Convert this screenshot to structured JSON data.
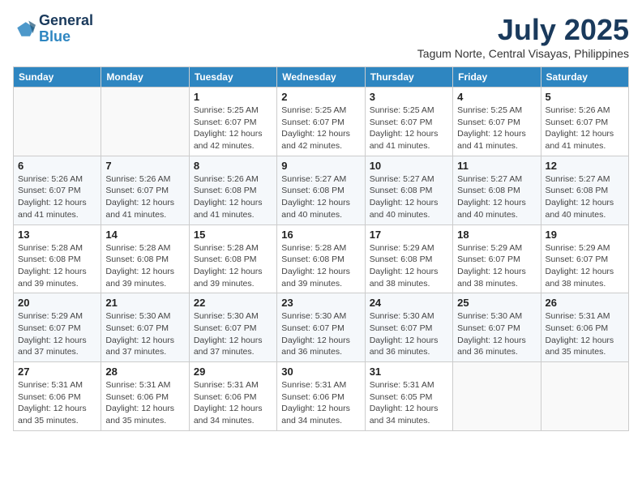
{
  "header": {
    "logo_line1": "General",
    "logo_line2": "Blue",
    "month": "July 2025",
    "location": "Tagum Norte, Central Visayas, Philippines"
  },
  "weekdays": [
    "Sunday",
    "Monday",
    "Tuesday",
    "Wednesday",
    "Thursday",
    "Friday",
    "Saturday"
  ],
  "weeks": [
    [
      {
        "day": "",
        "info": ""
      },
      {
        "day": "",
        "info": ""
      },
      {
        "day": "1",
        "info": "Sunrise: 5:25 AM\nSunset: 6:07 PM\nDaylight: 12 hours and 42 minutes."
      },
      {
        "day": "2",
        "info": "Sunrise: 5:25 AM\nSunset: 6:07 PM\nDaylight: 12 hours and 42 minutes."
      },
      {
        "day": "3",
        "info": "Sunrise: 5:25 AM\nSunset: 6:07 PM\nDaylight: 12 hours and 41 minutes."
      },
      {
        "day": "4",
        "info": "Sunrise: 5:25 AM\nSunset: 6:07 PM\nDaylight: 12 hours and 41 minutes."
      },
      {
        "day": "5",
        "info": "Sunrise: 5:26 AM\nSunset: 6:07 PM\nDaylight: 12 hours and 41 minutes."
      }
    ],
    [
      {
        "day": "6",
        "info": "Sunrise: 5:26 AM\nSunset: 6:07 PM\nDaylight: 12 hours and 41 minutes."
      },
      {
        "day": "7",
        "info": "Sunrise: 5:26 AM\nSunset: 6:07 PM\nDaylight: 12 hours and 41 minutes."
      },
      {
        "day": "8",
        "info": "Sunrise: 5:26 AM\nSunset: 6:08 PM\nDaylight: 12 hours and 41 minutes."
      },
      {
        "day": "9",
        "info": "Sunrise: 5:27 AM\nSunset: 6:08 PM\nDaylight: 12 hours and 40 minutes."
      },
      {
        "day": "10",
        "info": "Sunrise: 5:27 AM\nSunset: 6:08 PM\nDaylight: 12 hours and 40 minutes."
      },
      {
        "day": "11",
        "info": "Sunrise: 5:27 AM\nSunset: 6:08 PM\nDaylight: 12 hours and 40 minutes."
      },
      {
        "day": "12",
        "info": "Sunrise: 5:27 AM\nSunset: 6:08 PM\nDaylight: 12 hours and 40 minutes."
      }
    ],
    [
      {
        "day": "13",
        "info": "Sunrise: 5:28 AM\nSunset: 6:08 PM\nDaylight: 12 hours and 39 minutes."
      },
      {
        "day": "14",
        "info": "Sunrise: 5:28 AM\nSunset: 6:08 PM\nDaylight: 12 hours and 39 minutes."
      },
      {
        "day": "15",
        "info": "Sunrise: 5:28 AM\nSunset: 6:08 PM\nDaylight: 12 hours and 39 minutes."
      },
      {
        "day": "16",
        "info": "Sunrise: 5:28 AM\nSunset: 6:08 PM\nDaylight: 12 hours and 39 minutes."
      },
      {
        "day": "17",
        "info": "Sunrise: 5:29 AM\nSunset: 6:08 PM\nDaylight: 12 hours and 38 minutes."
      },
      {
        "day": "18",
        "info": "Sunrise: 5:29 AM\nSunset: 6:07 PM\nDaylight: 12 hours and 38 minutes."
      },
      {
        "day": "19",
        "info": "Sunrise: 5:29 AM\nSunset: 6:07 PM\nDaylight: 12 hours and 38 minutes."
      }
    ],
    [
      {
        "day": "20",
        "info": "Sunrise: 5:29 AM\nSunset: 6:07 PM\nDaylight: 12 hours and 37 minutes."
      },
      {
        "day": "21",
        "info": "Sunrise: 5:30 AM\nSunset: 6:07 PM\nDaylight: 12 hours and 37 minutes."
      },
      {
        "day": "22",
        "info": "Sunrise: 5:30 AM\nSunset: 6:07 PM\nDaylight: 12 hours and 37 minutes."
      },
      {
        "day": "23",
        "info": "Sunrise: 5:30 AM\nSunset: 6:07 PM\nDaylight: 12 hours and 36 minutes."
      },
      {
        "day": "24",
        "info": "Sunrise: 5:30 AM\nSunset: 6:07 PM\nDaylight: 12 hours and 36 minutes."
      },
      {
        "day": "25",
        "info": "Sunrise: 5:30 AM\nSunset: 6:07 PM\nDaylight: 12 hours and 36 minutes."
      },
      {
        "day": "26",
        "info": "Sunrise: 5:31 AM\nSunset: 6:06 PM\nDaylight: 12 hours and 35 minutes."
      }
    ],
    [
      {
        "day": "27",
        "info": "Sunrise: 5:31 AM\nSunset: 6:06 PM\nDaylight: 12 hours and 35 minutes."
      },
      {
        "day": "28",
        "info": "Sunrise: 5:31 AM\nSunset: 6:06 PM\nDaylight: 12 hours and 35 minutes."
      },
      {
        "day": "29",
        "info": "Sunrise: 5:31 AM\nSunset: 6:06 PM\nDaylight: 12 hours and 34 minutes."
      },
      {
        "day": "30",
        "info": "Sunrise: 5:31 AM\nSunset: 6:06 PM\nDaylight: 12 hours and 34 minutes."
      },
      {
        "day": "31",
        "info": "Sunrise: 5:31 AM\nSunset: 6:05 PM\nDaylight: 12 hours and 34 minutes."
      },
      {
        "day": "",
        "info": ""
      },
      {
        "day": "",
        "info": ""
      }
    ]
  ]
}
